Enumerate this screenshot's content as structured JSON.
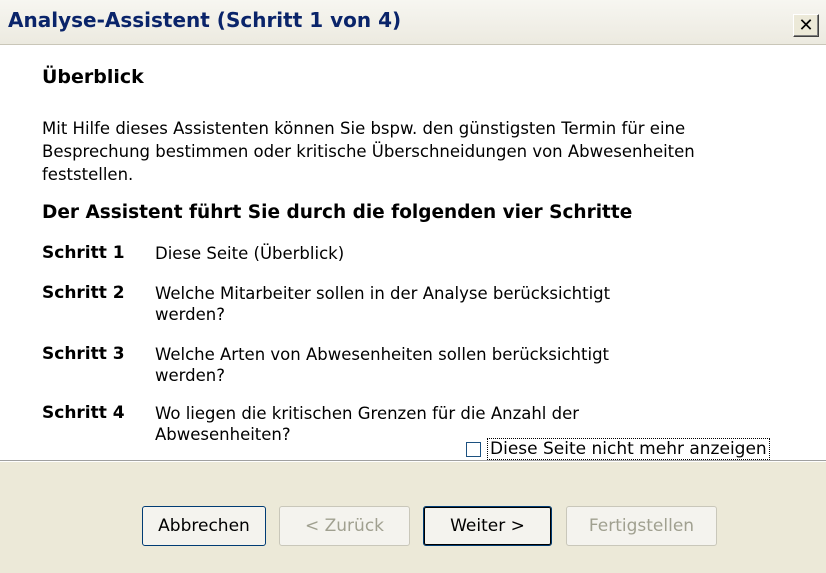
{
  "window": {
    "title": "Analyse-Assistent (Schritt 1 von 4)",
    "close_glyph": "✕"
  },
  "content": {
    "heading": "Überblick",
    "intro_lines": [
      "Mit Hilfe dieses Assistenten können Sie bspw. den günstigsten Termin für eine",
      "Besprechung bestimmen oder kritische Überschneidungen von Abwesenheiten",
      "feststellen."
    ],
    "steps_heading": "Der Assistent führt Sie durch die folgenden vier Schritte",
    "steps": [
      {
        "label": "Schritt 1",
        "lines": [
          "Diese Seite (Überblick)"
        ]
      },
      {
        "label": "Schritt 2",
        "lines": [
          "Welche Mitarbeiter sollen in der Analyse berücksichtigt",
          "werden?"
        ]
      },
      {
        "label": "Schritt 3",
        "lines": [
          "Welche Arten von Abwesenheiten sollen berücksichtigt",
          "werden?"
        ]
      },
      {
        "label": "Schritt 4",
        "lines": [
          "Wo liegen die kritischen Grenzen für die Anzahl der",
          "Abwesenheiten?"
        ]
      }
    ],
    "dont_show_checkbox": {
      "label": "Diese Seite nicht mehr anzeigen",
      "checked": false
    }
  },
  "buttons": {
    "cancel": "Abbrechen",
    "back": "< Zurück",
    "next": "Weiter >",
    "finish": "Fertigstellen"
  }
}
